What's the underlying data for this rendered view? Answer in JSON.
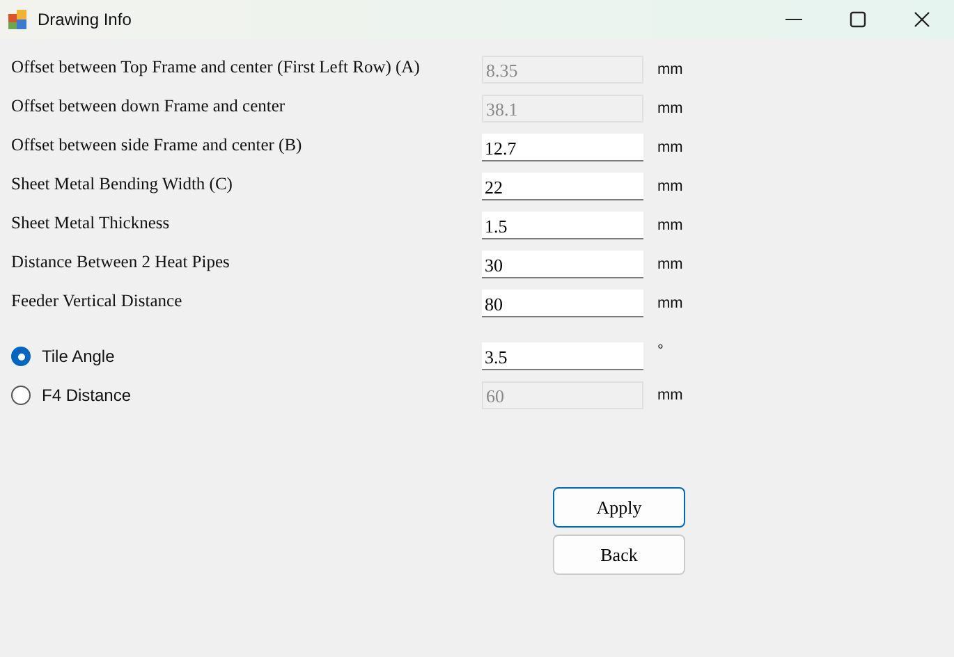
{
  "window": {
    "title": "Drawing Info"
  },
  "fields": [
    {
      "label": "Offset between Top Frame and center (First Left Row) (A)",
      "value": "8.35",
      "unit": "mm",
      "disabled": true
    },
    {
      "label": "Offset between down Frame and center",
      "value": "38.1",
      "unit": "mm",
      "disabled": true
    },
    {
      "label": "Offset between side Frame and center (B)",
      "value": "12.7",
      "unit": "mm",
      "disabled": false
    },
    {
      "label": "Sheet Metal Bending Width (C)",
      "value": "22",
      "unit": "mm",
      "disabled": false
    },
    {
      "label": "Sheet Metal Thickness",
      "value": "1.5",
      "unit": "mm",
      "disabled": false
    },
    {
      "label": "Distance Between 2 Heat Pipes",
      "value": "30",
      "unit": "mm",
      "disabled": false
    },
    {
      "label": "Feeder Vertical Distance",
      "value": "80",
      "unit": "mm",
      "disabled": false
    }
  ],
  "options": [
    {
      "label": "Tile Angle",
      "selected": true,
      "value": "3.5",
      "unit": "°",
      "disabled": false
    },
    {
      "label": "F4 Distance",
      "selected": false,
      "value": "60",
      "unit": "mm",
      "disabled": true
    }
  ],
  "buttons": [
    "Apply",
    "Back"
  ]
}
